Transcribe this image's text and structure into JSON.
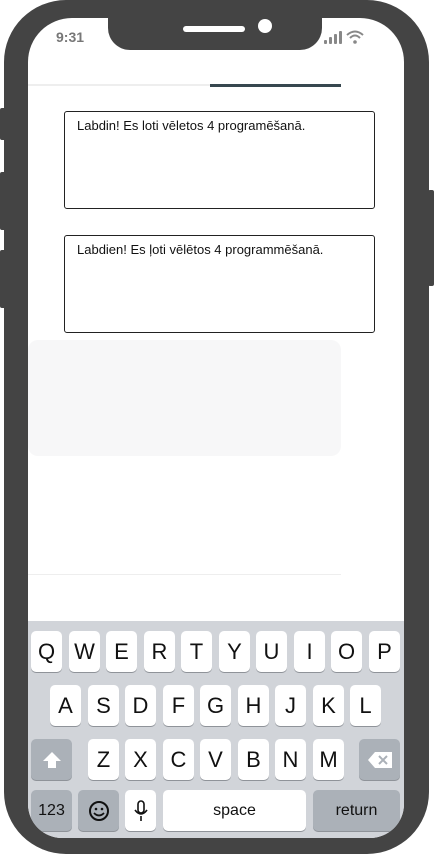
{
  "status_bar": {
    "time": "9:31"
  },
  "text_fields": {
    "first": "Labdin! Es loti vēletos 4 programēšanā.",
    "second": "Labdien! Es ļoti vēlētos 4 programmēšanā."
  },
  "keyboard": {
    "row1": [
      "Q",
      "W",
      "E",
      "R",
      "T",
      "Y",
      "U",
      "I",
      "O",
      "P"
    ],
    "row2": [
      "A",
      "S",
      "D",
      "F",
      "G",
      "H",
      "J",
      "K",
      "L"
    ],
    "row3": [
      "Z",
      "X",
      "C",
      "V",
      "B",
      "N",
      "M"
    ],
    "numbers_label": "123",
    "space_label": "space",
    "return_label": "return"
  },
  "icons": {
    "shift": "shift-icon",
    "backspace": "backspace-icon",
    "emoji": "emoji-icon",
    "mic": "microphone-icon",
    "signal": "signal-icon",
    "wifi": "wifi-icon"
  }
}
